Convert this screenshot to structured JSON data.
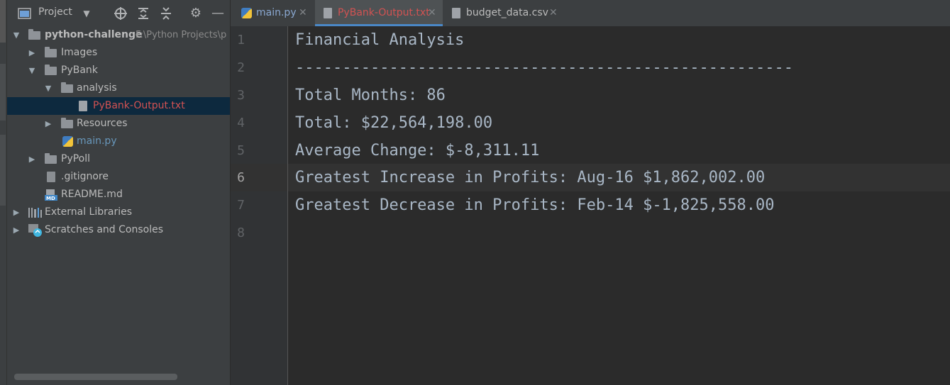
{
  "project_panel": {
    "title": "Project",
    "header_icons": [
      "panel-icon",
      "chevron-down-icon",
      "locate-icon",
      "expand-all-icon",
      "collapse-all-icon",
      "gear-icon",
      "minimize-icon"
    ],
    "tree": [
      {
        "label": "python-challenge",
        "path": "F:\\Python Projects\\p",
        "type": "folder",
        "expanded": true
      },
      {
        "label": "Images",
        "type": "folder",
        "expanded": false
      },
      {
        "label": "PyBank",
        "type": "folder",
        "expanded": true
      },
      {
        "label": "analysis",
        "type": "folder",
        "expanded": true
      },
      {
        "label": "PyBank-Output.txt",
        "type": "text-file",
        "selected": true
      },
      {
        "label": "Resources",
        "type": "folder",
        "expanded": false
      },
      {
        "label": "main.py",
        "type": "python-file"
      },
      {
        "label": "PyPoll",
        "type": "folder",
        "expanded": false
      },
      {
        "label": ".gitignore",
        "type": "gitignore-file"
      },
      {
        "label": "README.md",
        "type": "markdown-file"
      },
      {
        "label": "External Libraries",
        "type": "libraries"
      },
      {
        "label": "Scratches and Consoles",
        "type": "scratches"
      }
    ]
  },
  "tabs": [
    {
      "label": "main.py",
      "icon": "python-file-icon",
      "active": false
    },
    {
      "label": "PyBank-Output.txt",
      "icon": "text-file-icon",
      "active": true
    },
    {
      "label": "budget_data.csv",
      "icon": "csv-file-icon",
      "active": false
    }
  ],
  "editor": {
    "line_numbers": [
      "1",
      "2",
      "3",
      "4",
      "5",
      "6",
      "7",
      "8"
    ],
    "current_line": "6",
    "lines": [
      "Financial Analysis",
      "-----------------------------------------------------",
      "Total Months: 86",
      "Total: $22,564,198.00",
      "Average Change: $-8,311.11",
      "Greatest Increase in Profits: Aug-16 $1,862,002.00",
      "Greatest Decrease in Profits: Feb-14 $-1,825,558.00",
      ""
    ]
  },
  "colors": {
    "selected_text": "#d25252",
    "python_file_text": "#6897bb",
    "active_tab_text": "#d25252",
    "inactive_tab_text": "#8aa8d1"
  }
}
